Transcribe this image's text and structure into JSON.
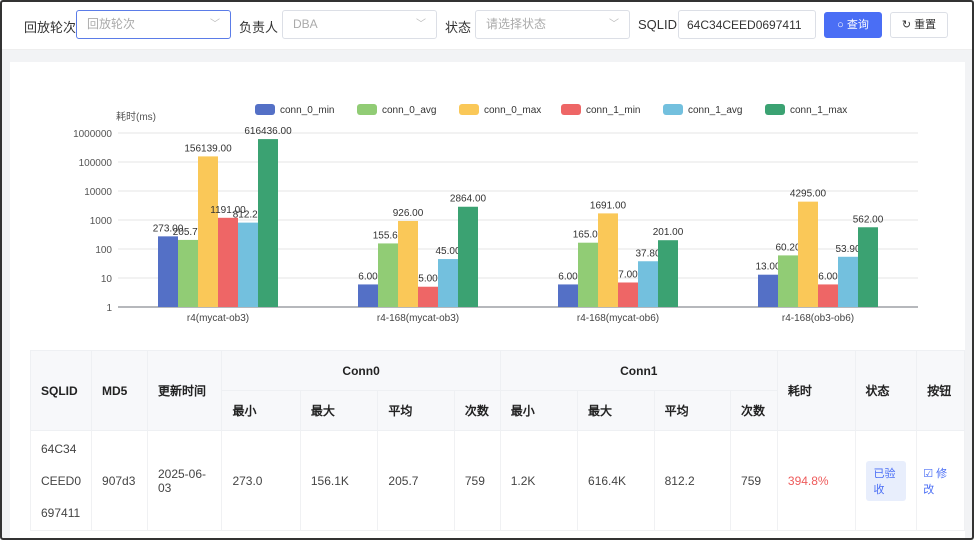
{
  "filters": {
    "round_label": "回放轮次",
    "round_placeholder": "回放轮次",
    "owner_label": "负责人",
    "owner_value": "DBA",
    "status_label": "状态",
    "status_placeholder": "请选择状态",
    "sqlid_label": "SQLID",
    "sqlid_value": "64C34CEED0697411",
    "query_button": "查询",
    "reset_button": "重置"
  },
  "chart_data": {
    "type": "bar",
    "ylabel": "耗时(ms)",
    "yscale": "log",
    "ylim": [
      1,
      1000000
    ],
    "yticks": [
      "1",
      "10",
      "100",
      "1000",
      "10000",
      "100000",
      "1000000"
    ],
    "legend_position": "top",
    "categories": [
      "r4(mycat-ob3)",
      "r4-168(mycat-ob3)",
      "r4-168(mycat-ob6)",
      "r4-168(ob3-ob6)"
    ],
    "series": [
      {
        "name": "conn_0_min",
        "color": "#5470c6",
        "values": [
          273,
          6,
          6,
          13
        ]
      },
      {
        "name": "conn_0_avg",
        "color": "#91cc75",
        "values": [
          205.7,
          155.6,
          165,
          60.2
        ]
      },
      {
        "name": "conn_0_max",
        "color": "#fac858",
        "values": [
          156139,
          926,
          1691,
          4295
        ]
      },
      {
        "name": "conn_1_min",
        "color": "#ee6666",
        "values": [
          1191,
          5,
          7,
          6
        ]
      },
      {
        "name": "conn_1_avg",
        "color": "#73c0de",
        "values": [
          812.2,
          45,
          37.8,
          53.9
        ]
      },
      {
        "name": "conn_1_max",
        "color": "#3ba272",
        "values": [
          616436,
          2864,
          201,
          562
        ]
      }
    ]
  },
  "table": {
    "headers": {
      "sqlid": "SQLID",
      "md5": "MD5",
      "updated": "更新时间",
      "conn0": "Conn0",
      "conn1": "Conn1",
      "cost": "耗时",
      "status": "状态",
      "actions": "按钮",
      "sub": [
        "最小",
        "最大",
        "平均",
        "次数",
        "最小",
        "最大",
        "平均",
        "次数"
      ]
    },
    "rows": [
      {
        "sqlid": [
          "64C34",
          "CEED0",
          "697411"
        ],
        "md5": "907d3",
        "updated": "2025-06-03",
        "c0": [
          "273.0",
          "156.1K",
          "205.7",
          "759"
        ],
        "c1": [
          "1.2K",
          "616.4K",
          "812.2",
          "759"
        ],
        "cost": "394.8%",
        "status": "已验收",
        "action": "修改"
      }
    ]
  }
}
